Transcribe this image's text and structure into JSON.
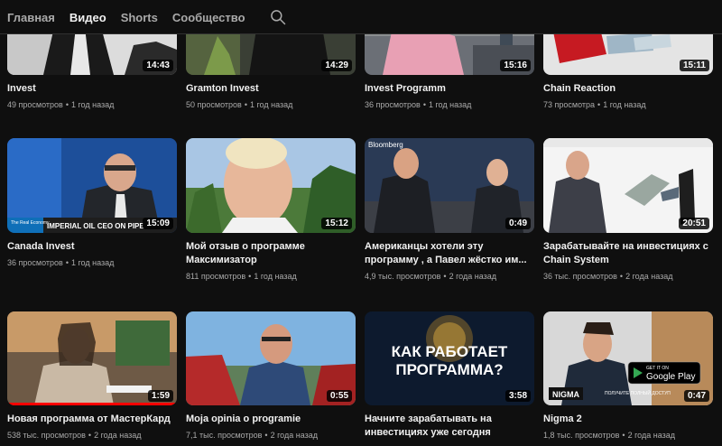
{
  "tabs": [
    {
      "label": "Главная",
      "active": false
    },
    {
      "label": "Видео",
      "active": true
    },
    {
      "label": "Shorts",
      "active": false
    },
    {
      "label": "Сообщество",
      "active": false
    }
  ],
  "search": {
    "icon": "search-icon"
  },
  "videos": [
    {
      "title": "Invest",
      "views": "49 просмотров",
      "age": "1 год назад",
      "duration": "14:43"
    },
    {
      "title": "Gramton Invest",
      "views": "50 просмотров",
      "age": "1 год назад",
      "duration": "14:29"
    },
    {
      "title": "Invest Programm",
      "views": "36 просмотров",
      "age": "1 год назад",
      "duration": "15:16"
    },
    {
      "title": "Chain Reaction",
      "views": "73 просмотра",
      "age": "1 год назад",
      "duration": "15:11"
    },
    {
      "title": "Canada Invest",
      "views": "36 просмотров",
      "age": "1 год назад",
      "duration": "15:09",
      "overlay": {
        "banner": "IMPERIAL OIL CEO ON PIPE",
        "badge": "The Real Economy"
      }
    },
    {
      "title": "Мой отзыв о программе Максимизатор",
      "views": "811 просмотров",
      "age": "1 год назад",
      "duration": "15:12"
    },
    {
      "title": "Американцы хотели эту программу , а Павел жёстко им...",
      "views": "4,9 тыс. просмотров",
      "age": "2 года назад",
      "duration": "0:49",
      "overlay": {
        "brand": "Bloomberg"
      }
    },
    {
      "title": "Зарабатывайте на инвестициях с Chain System",
      "views": "36 тыс. просмотров",
      "age": "2 года назад",
      "duration": "20:51"
    },
    {
      "title": "Новая программа от МастерКард",
      "views": "538 тыс. просмотров",
      "age": "2 года назад",
      "duration": "1:59"
    },
    {
      "title": "Moja opinia o programie",
      "views": "7,1 тыс. просмотров",
      "age": "2 года назад",
      "duration": "0:55"
    },
    {
      "title": "Начните зарабатывать на инвестициях уже сегодня",
      "views": "",
      "age": "",
      "duration": "3:58",
      "overlay": {
        "headline_1": "КАК РАБОТАЕТ",
        "headline_2": "ПРОГРАММА?"
      }
    },
    {
      "title": "Nigma 2",
      "views": "1,8 тыс. просмотров",
      "age": "2 года назад",
      "duration": "0:47",
      "overlay": {
        "logo": "NIGMA",
        "store_top": "GET IT ON",
        "store_name": "Google Play",
        "cta": "ПОЛУЧИТЕ ПОЛНЫЙ ДОСТУП"
      }
    }
  ],
  "colors": {
    "background": "#0f0f0f",
    "text": "#f1f1f1",
    "secondary_text": "#aaaaaa",
    "progress": "#ff0000"
  }
}
